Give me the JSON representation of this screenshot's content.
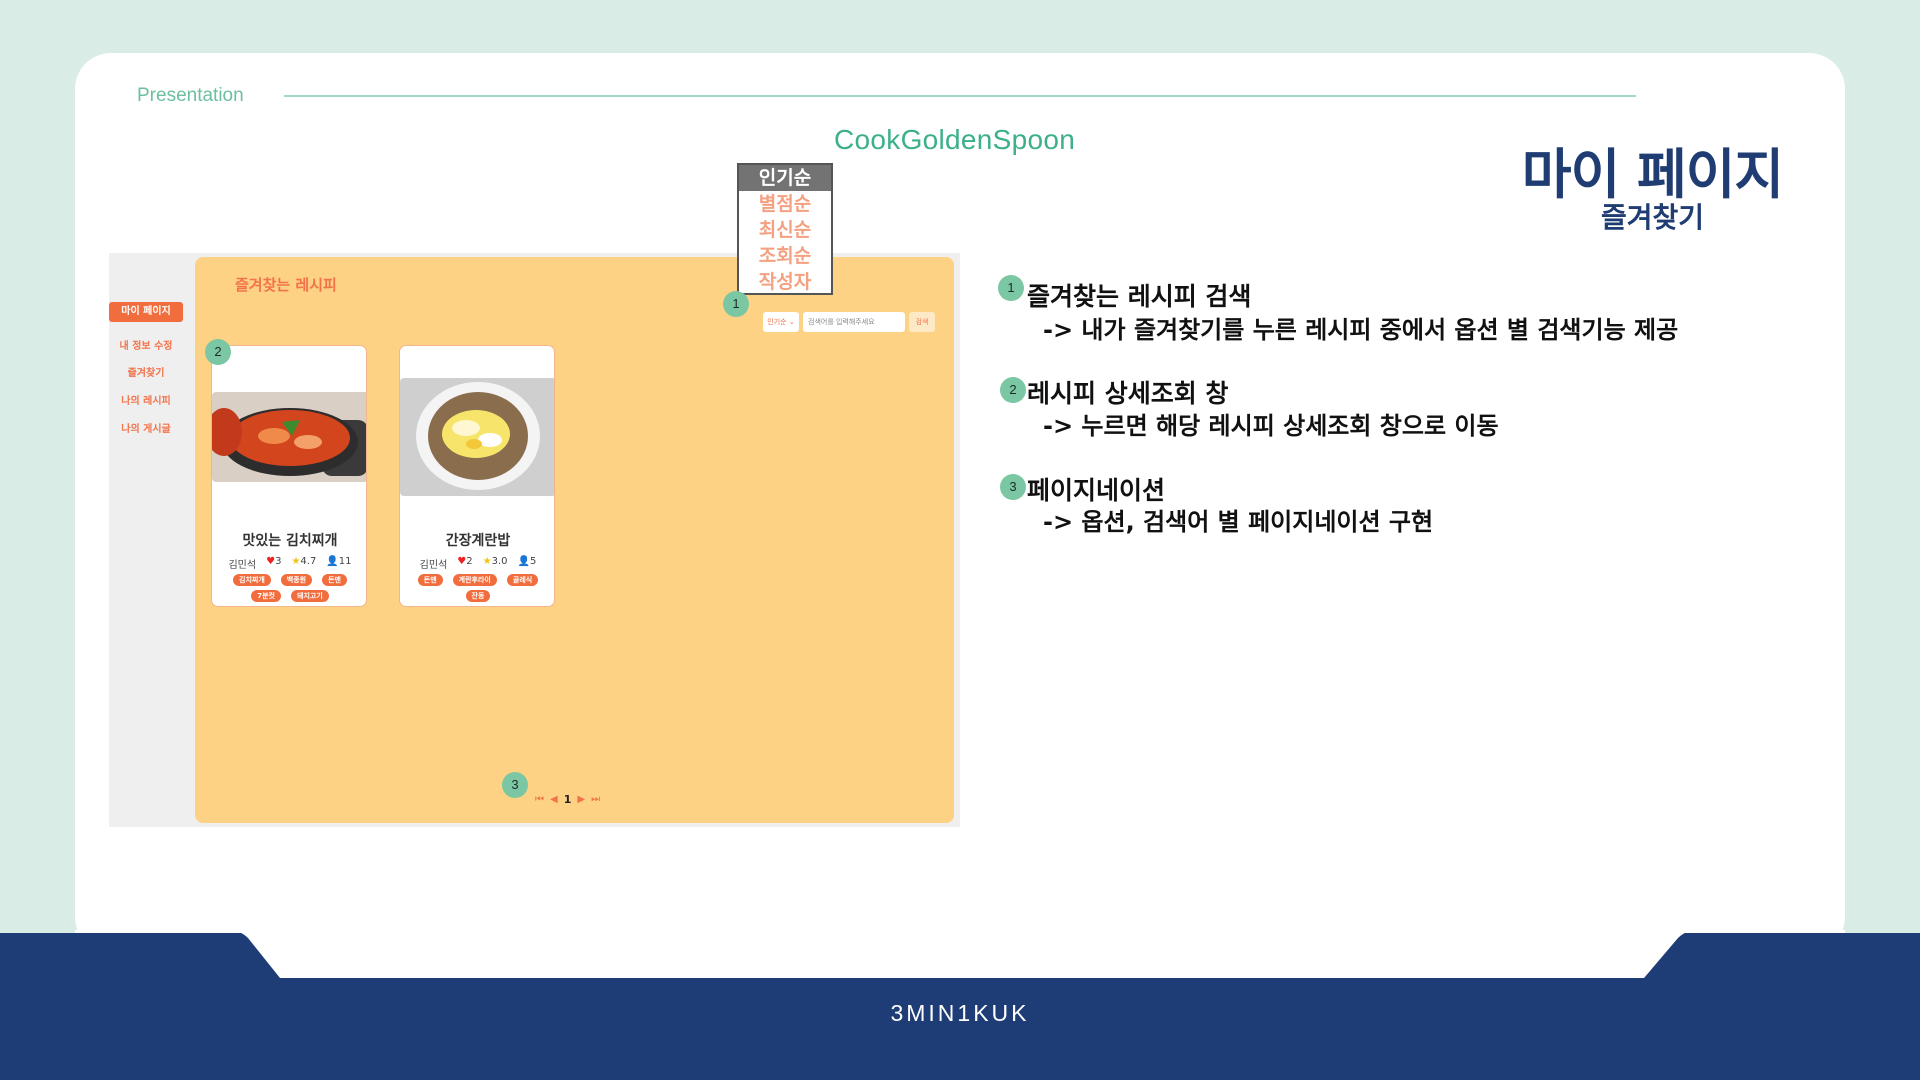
{
  "slide": {
    "label": "Presentation",
    "brand": "CookGoldenSpoon",
    "title": "마이 페이지",
    "subtitle": "즐겨찾기",
    "footer": "3MIN1KUK"
  },
  "mock": {
    "sidebar": [
      "마이 페이지",
      "내 정보 수정",
      "즐겨찾기",
      "나의 레시피",
      "나의 게시글"
    ],
    "main_title": "즐겨찾는 레시피",
    "search": {
      "select": "인기순 ⌄",
      "placeholder": "검색어를 입력해주세요",
      "button": "검색"
    },
    "cards": [
      {
        "title": "맛있는 김치찌개",
        "author": "김민석",
        "likes": "3",
        "rating": "4.7",
        "views": "11",
        "tags": [
          "김치찌개",
          "백종원",
          "돈맨",
          "7분컷",
          "돼지고기"
        ]
      },
      {
        "title": "간장계란밥",
        "author": "김민석",
        "likes": "2",
        "rating": "3.0",
        "views": "5",
        "tags": [
          "돈맨",
          "계란후라이",
          "골레식",
          "잔동"
        ]
      }
    ],
    "pager": {
      "current": "1"
    }
  },
  "dropdown": [
    "인기순",
    "별점순",
    "최신순",
    "조회순",
    "작성자"
  ],
  "badges": [
    "1",
    "2",
    "3"
  ],
  "descriptions": [
    {
      "num": "1",
      "head": "즐겨찾는 레시피 검색",
      "sub": "-> 내가 즐겨찾기를 누른 레시피 중에서 옵션 별 검색기능 제공"
    },
    {
      "num": "2",
      "head": "레시피 상세조회 창",
      "sub": "-> 누르면 해당 레시피 상세조회 창으로 이동"
    },
    {
      "num": "3",
      "head": "페이지네이션",
      "sub": "-> 옵션, 검색어 별 페이지네이션 구현"
    }
  ],
  "colors": {
    "accent": "#f26d3d",
    "panel": "#fdd285",
    "navy": "#1e3c75",
    "mint": "#7cc7a3"
  }
}
